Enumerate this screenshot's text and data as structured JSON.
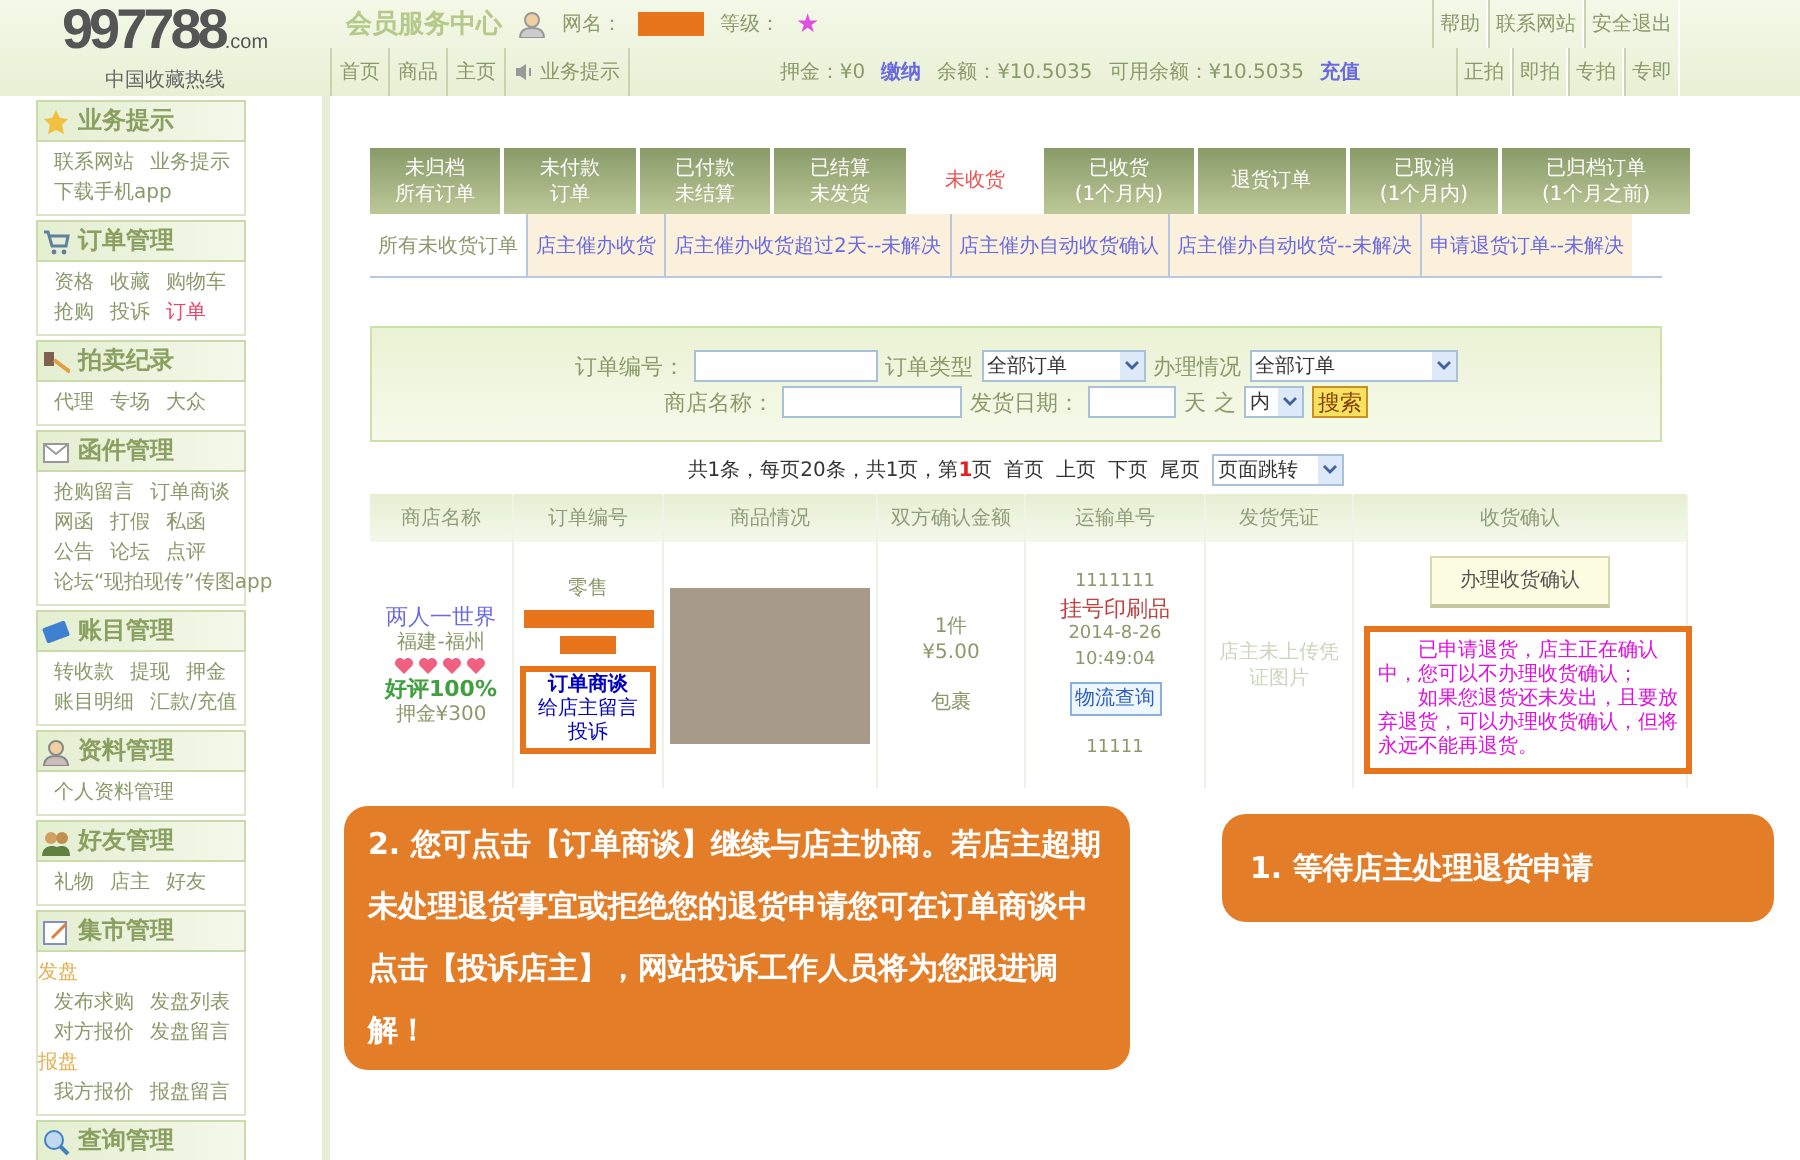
{
  "header": {
    "logo": {
      "brand": "997788",
      "domain": ".com",
      "tagline": "中国收藏热线"
    },
    "title": "会员服务中心",
    "username_label": "网名：",
    "level_label": "等级：",
    "level_star": "★",
    "top_links": [
      "帮助",
      "联系网站",
      "安全退出"
    ],
    "nav": [
      "首页",
      "商品",
      "主页",
      "业务提示"
    ],
    "account": [
      {
        "kind": "text",
        "text": "押金：¥0"
      },
      {
        "kind": "link",
        "text": "缴纳"
      },
      {
        "kind": "text",
        "text": "余额：¥10.5035"
      },
      {
        "kind": "text",
        "text": "可用余额：¥10.5035"
      },
      {
        "kind": "link",
        "text": "充值"
      }
    ],
    "mode_links": [
      "正拍",
      "即拍",
      "专拍",
      "专即"
    ]
  },
  "sidebar": {
    "sections": [
      {
        "title": "业务提示",
        "items": [
          {
            "kind": "link",
            "label": "联系网站",
            "selected": false
          },
          {
            "kind": "link",
            "label": "业务提示",
            "selected": false
          },
          {
            "kind": "link",
            "label": "下载手机app",
            "selected": false
          }
        ]
      },
      {
        "title": "订单管理",
        "items": [
          {
            "kind": "link",
            "label": "资格",
            "selected": false
          },
          {
            "kind": "link",
            "label": "收藏",
            "selected": false
          },
          {
            "kind": "link",
            "label": "购物车",
            "selected": false
          },
          {
            "kind": "link",
            "label": "抢购",
            "selected": false
          },
          {
            "kind": "link",
            "label": "投诉",
            "selected": false
          },
          {
            "kind": "link",
            "label": "订单",
            "selected": true
          }
        ]
      },
      {
        "title": "拍卖纪录",
        "items": [
          {
            "kind": "link",
            "label": "代理",
            "selected": false
          },
          {
            "kind": "link",
            "label": "专场",
            "selected": false
          },
          {
            "kind": "link",
            "label": "大众",
            "selected": false
          }
        ]
      },
      {
        "title": "函件管理",
        "items": [
          {
            "kind": "link",
            "label": "抢购留言",
            "selected": false
          },
          {
            "kind": "link",
            "label": "订单商谈",
            "selected": false
          },
          {
            "kind": "link",
            "label": "网函",
            "selected": false
          },
          {
            "kind": "link",
            "label": "打假",
            "selected": false
          },
          {
            "kind": "link",
            "label": "私函",
            "selected": false
          },
          {
            "kind": "link",
            "label": "公告",
            "selected": false
          },
          {
            "kind": "link",
            "label": "论坛",
            "selected": false
          },
          {
            "kind": "link",
            "label": "点评",
            "selected": false
          },
          {
            "kind": "link",
            "label": "论坛“现拍现传”传图app",
            "selected": false
          }
        ]
      },
      {
        "title": "账目管理",
        "items": [
          {
            "kind": "link",
            "label": "转收款",
            "selected": false
          },
          {
            "kind": "link",
            "label": "提现",
            "selected": false
          },
          {
            "kind": "link",
            "label": "押金",
            "selected": false
          },
          {
            "kind": "link",
            "label": "账目明细",
            "selected": false
          },
          {
            "kind": "link",
            "label": "汇款/充值",
            "selected": false
          }
        ]
      },
      {
        "title": "资料管理",
        "items": [
          {
            "kind": "link",
            "label": "个人资料管理",
            "selected": false
          }
        ]
      },
      {
        "title": "好友管理",
        "items": [
          {
            "kind": "link",
            "label": "礼物",
            "selected": false
          },
          {
            "kind": "link",
            "label": "店主",
            "selected": false
          },
          {
            "kind": "link",
            "label": "好友",
            "selected": false
          }
        ]
      },
      {
        "title": "集市管理",
        "items": [
          {
            "kind": "group",
            "label": "发盘"
          },
          {
            "kind": "link",
            "label": "发布求购",
            "selected": false
          },
          {
            "kind": "link",
            "label": "发盘列表",
            "selected": false
          },
          {
            "kind": "link",
            "label": "对方报价",
            "selected": false
          },
          {
            "kind": "link",
            "label": "发盘留言",
            "selected": false
          },
          {
            "kind": "group",
            "label": "报盘"
          },
          {
            "kind": "link",
            "label": "我方报价",
            "selected": false
          },
          {
            "kind": "link",
            "label": "报盘留言",
            "selected": false
          }
        ]
      },
      {
        "title": "查询管理"
      }
    ]
  },
  "tabs": [
    {
      "lines": [
        "未归档",
        "所有订单"
      ],
      "selected": false
    },
    {
      "lines": [
        "未付款",
        "订单"
      ],
      "selected": false
    },
    {
      "lines": [
        "已付款",
        "未结算"
      ],
      "selected": false
    },
    {
      "lines": [
        "已结算",
        "未发货"
      ],
      "selected": false
    },
    {
      "lines": [
        "未收货"
      ],
      "selected": true
    },
    {
      "lines": [
        "已收货",
        "(1个月内)"
      ],
      "selected": false
    },
    {
      "lines": [
        "退货订单"
      ],
      "selected": false
    },
    {
      "lines": [
        "已取消",
        "(1个月内)"
      ],
      "selected": false
    },
    {
      "lines": [
        "已归档订单",
        "(1个月之前)"
      ],
      "selected": false
    }
  ],
  "subtabs": [
    {
      "label": "所有未收货订单",
      "selected": true
    },
    {
      "label": "店主催办收货",
      "selected": false
    },
    {
      "label": "店主催办收货超过2天--未解决",
      "selected": false
    },
    {
      "label": "店主催办自动收货确认",
      "selected": false
    },
    {
      "label": "店主催办自动收货--未解决",
      "selected": false
    },
    {
      "label": "申请退货订单--未解决",
      "selected": false
    }
  ],
  "search": {
    "order_no_label": "订单编号：",
    "order_type_label": "订单类型",
    "order_type_value": "全部订单",
    "status_label": "办理情况",
    "status_value": "全部订单",
    "shop_label": "商店名称：",
    "ship_date_label": "发货日期：",
    "days_label": "天",
    "of_label": "之",
    "range_value": "内",
    "button": "搜索"
  },
  "pagination": {
    "summary": "共1条，每页20条，共1页，第**1**页",
    "links": [
      "首页",
      "上页",
      "下页",
      "尾页"
    ],
    "jump_value": "页面跳转"
  },
  "table": {
    "columns": [
      "商店名称",
      "订单编号",
      "商品情况",
      "双方确认金额",
      "运输单号",
      "发货凭证",
      "收货确认"
    ],
    "row": {
      "shop_name": "两人一世界",
      "shop_location": "福建-福州",
      "rating": "好评100%",
      "deposit": "押金¥300",
      "order_kind": "零售",
      "order_links": [
        "订单商谈",
        "给店主留言",
        "投诉"
      ],
      "quantity": "1件",
      "amount": "¥5.00",
      "packaging": "包裹",
      "tracking_no": "1111111",
      "shipping_method": "挂号印刷品",
      "ship_time": "2014-8-26 10:49:04",
      "track_button": "物流查询",
      "code": "11111",
      "voucher": "店主未上传凭证图片",
      "confirm_button": "办理收货确认",
      "notice": [
        "已申请退货，店主正在确认中，您可以不办理收货确认；",
        "如果您退货还未发出，且要放弃退货，可以办理收货确认，但将永远不能再退货。"
      ]
    }
  },
  "callouts": [
    "2. 您可点击【订单商谈】继续与店主协商。若店主超期未处理退货事宜或拒绝您的退货申请您可在订单商谈中点击【投诉店主】，网站投诉工作人员将为您跟进调解！",
    "1. 等待店主处理退货申请"
  ]
}
